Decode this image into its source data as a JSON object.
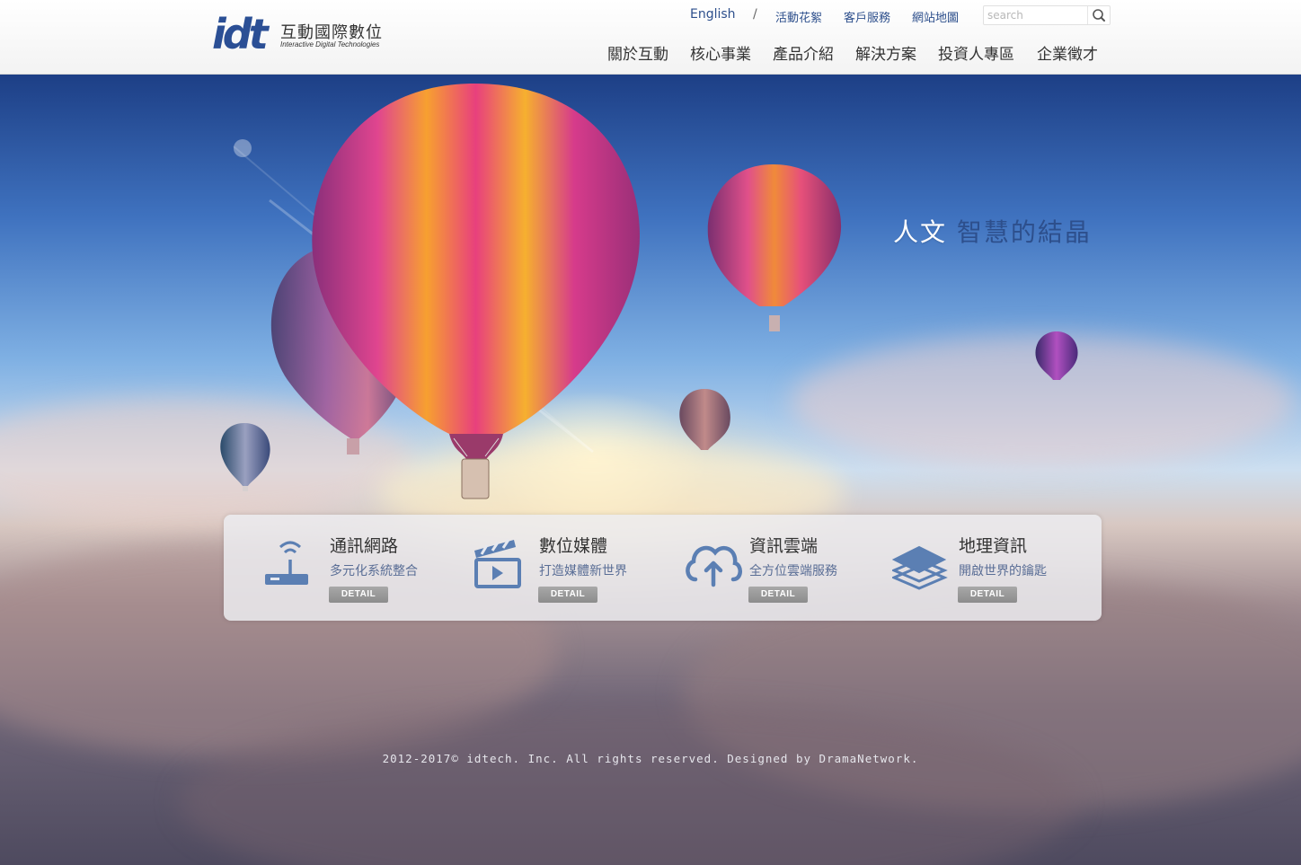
{
  "logo": {
    "mark": "idt",
    "name_cn": "互動國際數位",
    "name_en": "Interactive Digital Technologies"
  },
  "top_links": {
    "english": "English",
    "separator": "/",
    "events": "活動花絮",
    "service": "客戶服務",
    "sitemap": "網站地圖"
  },
  "search": {
    "placeholder": "search",
    "icon": "search-icon"
  },
  "main_nav": [
    {
      "label": "關於互動"
    },
    {
      "label": "核心事業"
    },
    {
      "label": "產品介紹"
    },
    {
      "label": "解決方案"
    },
    {
      "label": "投資人專區"
    },
    {
      "label": "企業徵才"
    }
  ],
  "hero": {
    "slogan_plain": "人文",
    "slogan_accent": "智慧的結晶"
  },
  "features": [
    {
      "title": "通訊網路",
      "subtitle": "多元化系統整合",
      "button": "DETAIL",
      "icon": "router-icon"
    },
    {
      "title": "數位媒體",
      "subtitle": "打造媒體新世界",
      "button": "DETAIL",
      "icon": "clapperboard-icon"
    },
    {
      "title": "資訊雲端",
      "subtitle": "全方位雲端服務",
      "button": "DETAIL",
      "icon": "cloud-upload-icon"
    },
    {
      "title": "地理資訊",
      "subtitle": "開啟世界的鑰匙",
      "button": "DETAIL",
      "icon": "layers-icon"
    }
  ],
  "footer": {
    "copyright": "2012-2017© idtech. Inc. All rights reserved. Designed by DramaNetwork."
  },
  "colors": {
    "brand_blue": "#2d4f8c",
    "icon_blue": "#5b7fb3",
    "nav_text": "#333333"
  }
}
